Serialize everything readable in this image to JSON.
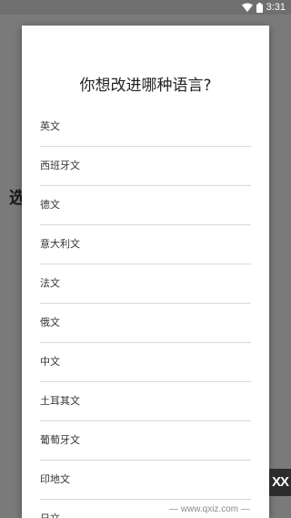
{
  "status_bar": {
    "time": "3:31",
    "icons": [
      "wifi-icon",
      "battery-icon"
    ]
  },
  "background": {
    "partial_heading": "选"
  },
  "dialog": {
    "title": "你想改进哪种语言?",
    "languages": [
      {
        "label": "英文"
      },
      {
        "label": "西班牙文"
      },
      {
        "label": "德文"
      },
      {
        "label": "意大利文"
      },
      {
        "label": "法文"
      },
      {
        "label": "俄文"
      },
      {
        "label": "中文"
      },
      {
        "label": "土耳其文"
      },
      {
        "label": "葡萄牙文"
      },
      {
        "label": "印地文"
      },
      {
        "label": "日文"
      }
    ]
  },
  "watermark": {
    "text": "— www.qxiz.com —",
    "logo_text": "XX"
  },
  "colors": {
    "overlay": "#7a7a7a",
    "dialog_bg": "#ffffff",
    "divider": "#d9d9d9",
    "title_text": "#222222",
    "item_text": "#333333"
  }
}
